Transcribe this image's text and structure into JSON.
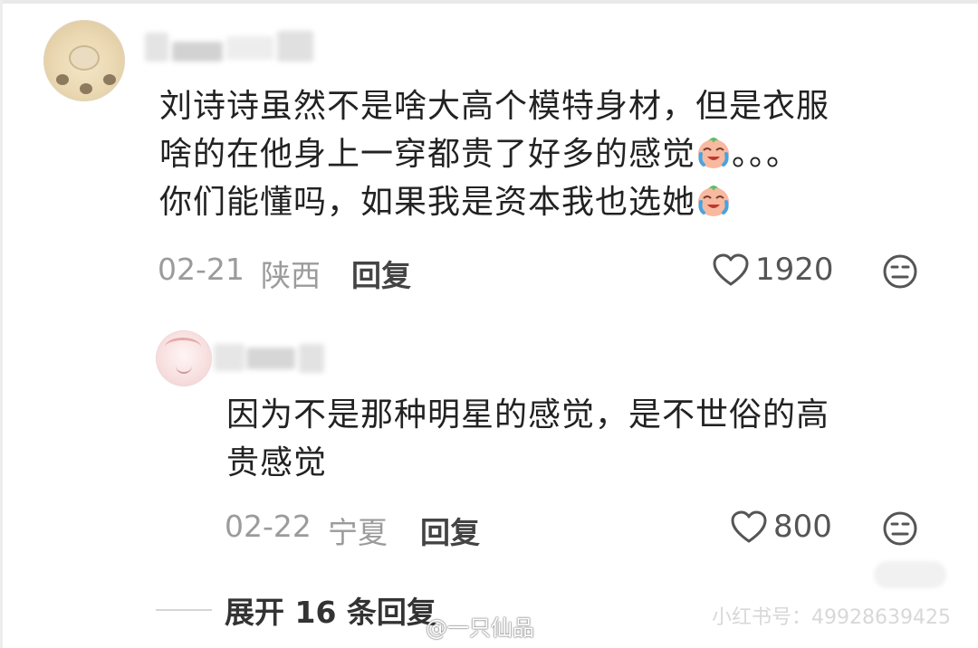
{
  "comments": [
    {
      "username_visible": "…乍色",
      "text_lines": [
        "刘诗诗虽然不是啥大高个模特身材，但是衣服",
        "啥的在他身上一穿都贵了好多的感觉",
        "。。。",
        "你们能懂吗，如果我是资本我也选她"
      ],
      "date": "02-21",
      "location": "陕西",
      "reply_label": "回复",
      "likes": "1920",
      "emoji": "crying-laughing-face-icon"
    },
    {
      "text_lines": [
        "因为不是那种明星的感觉，是不世俗的高",
        "贵感觉"
      ],
      "date": "02-22",
      "location": "宁夏",
      "reply_label": "回复",
      "likes": "800"
    }
  ],
  "expand_replies_label": "展开 16 条回复",
  "watermarks": {
    "weibo": "@一只仙品",
    "xiaohongshu": "小红书号：4992863942​5"
  },
  "colors": {
    "text": "#222222",
    "meta": "#9b9b9b",
    "background": "#ffffff"
  }
}
